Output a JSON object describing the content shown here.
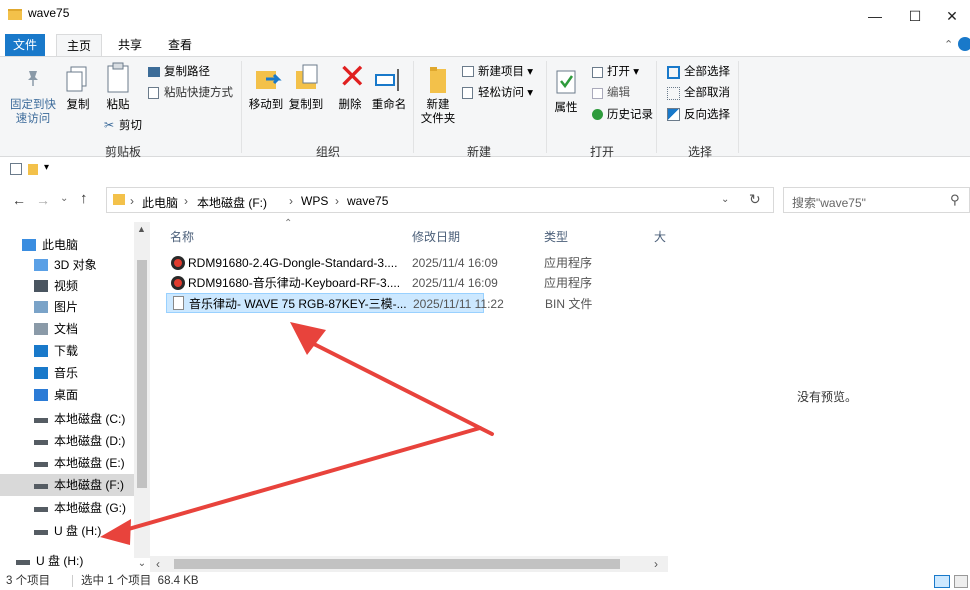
{
  "window": {
    "title": "wave75"
  },
  "menu": {
    "file": "文件",
    "home": "主页",
    "share": "共享",
    "view": "查看"
  },
  "ribbon": {
    "clipboard": {
      "pin": "固定到快\n速访问",
      "copy": "复制",
      "paste": "粘贴",
      "copy_path": "复制路径",
      "paste_shortcut": "粘贴快捷方式",
      "cut": "剪切",
      "label": "剪贴板"
    },
    "organize": {
      "move_to": "移动到",
      "copy_to": "复制到",
      "delete": "删除",
      "rename": "重命名",
      "label": "组织"
    },
    "new": {
      "new_folder": "新建\n文件夹",
      "new_item": "新建项目 ▾",
      "easy_access": "轻松访问 ▾",
      "label": "新建"
    },
    "open": {
      "properties": "属性",
      "open": "打开 ▾",
      "edit": "编辑",
      "history": "历史记录",
      "label": "打开"
    },
    "select": {
      "select_all": "全部选择",
      "select_none": "全部取消",
      "invert": "反向选择",
      "label": "选择"
    }
  },
  "breadcrumb": [
    "此电脑",
    "本地磁盘 (F:)",
    "WPS",
    "wave75"
  ],
  "search": {
    "placeholder": "搜索\"wave75\""
  },
  "nav": {
    "items": [
      {
        "label": "此电脑",
        "icon": "computer-icon"
      },
      {
        "label": "3D 对象",
        "icon": "3d-objects-icon"
      },
      {
        "label": "视频",
        "icon": "video-icon"
      },
      {
        "label": "图片",
        "icon": "pictures-icon"
      },
      {
        "label": "文档",
        "icon": "documents-icon"
      },
      {
        "label": "下载",
        "icon": "download-icon"
      },
      {
        "label": "音乐",
        "icon": "music-icon"
      },
      {
        "label": "桌面",
        "icon": "desktop-icon"
      },
      {
        "label": "本地磁盘 (C:)",
        "icon": "drive-icon"
      },
      {
        "label": "本地磁盘 (D:)",
        "icon": "drive-icon"
      },
      {
        "label": "本地磁盘 (E:)",
        "icon": "drive-icon"
      },
      {
        "label": "本地磁盘 (F:)",
        "icon": "drive-icon",
        "selected": true
      },
      {
        "label": "本地磁盘 (G:)",
        "icon": "drive-icon"
      },
      {
        "label": "U 盘 (H:)",
        "icon": "usb-drive-icon"
      },
      {
        "label": "U 盘 (H:)",
        "icon": "usb-drive-icon"
      }
    ]
  },
  "columns": {
    "name": "名称",
    "date": "修改日期",
    "type": "类型",
    "size": "大"
  },
  "files": [
    {
      "name": "RDM91680-2.4G-Dongle-Standard-3....",
      "date": "2025/11/4 16:09",
      "type": "应用程序",
      "icon": "app-icon"
    },
    {
      "name": "RDM91680-音乐律动-Keyboard-RF-3....",
      "date": "2025/11/4 16:09",
      "type": "应用程序",
      "icon": "app-icon"
    },
    {
      "name": "音乐律动- WAVE 75 RGB-87KEY-三模-...",
      "date": "2025/11/11 11:22",
      "type": "BIN 文件",
      "icon": "file-icon",
      "selected": true
    }
  ],
  "preview": {
    "text": "没有预览。"
  },
  "status": {
    "count": "3 个项目",
    "selected": "选中 1 个项目  68.4 KB"
  },
  "colors": {
    "accent": "#1979ca",
    "selection": "#cce8ff",
    "arrow": "#e8433c"
  }
}
